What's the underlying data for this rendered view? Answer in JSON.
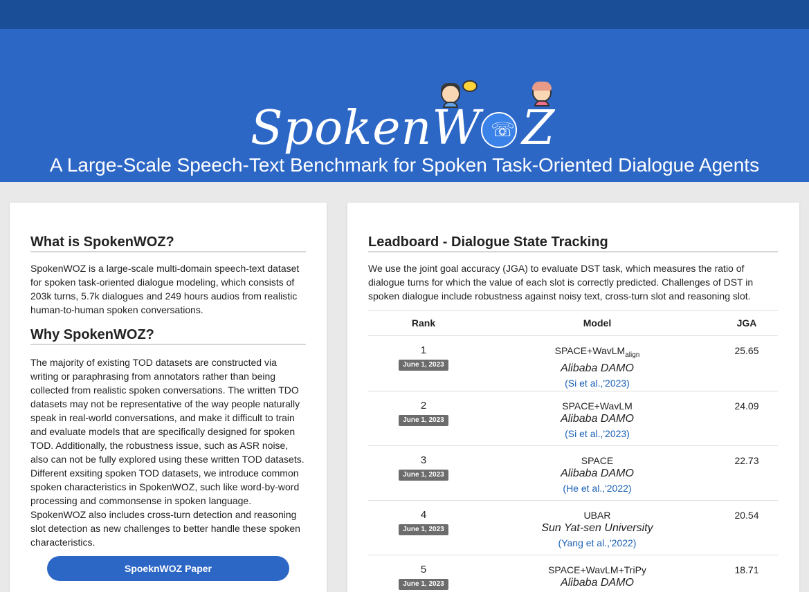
{
  "header": {
    "logo_text": "SpokenW",
    "logo_text_end": "Z",
    "phone_icon": "☏",
    "subtitle": "A Large-Scale Speech-Text Benchmark for Spoken Task-Oriented Dialogue Agents"
  },
  "about": {
    "what_title": "What is SpokenWOZ?",
    "what_text": "SpokenWOZ is a large-scale multi-domain speech-text dataset for spoken task-oriented dialogue modeling, which consists of 203k turns, 5.7k dialogues and 249 hours audios from realistic human-to-human spoken conversations.",
    "why_title": "Why SpokenWOZ?",
    "why_text": "The majority of existing TOD datasets are constructed via writing or paraphrasing from annotators rather than being collected from realistic spoken conversations. The written TDO datasets may not be representative of the way people naturally speak in real-world conversations, and make it difficult to train and evaluate models that are specifically designed for spoken TOD. Additionally, the robustness issue, such as ASR noise, also can not be fully explored using these written TOD datasets. Different exsiting spoken TOD datasets, we introduce common spoken characteristics in SpokenWOZ, such like word-by-word processing and commonsense in spoken language. SpokenWOZ also includes cross-turn detection and reasoning slot detection as new challenges to better handle these spoken characteristics.",
    "paper_button": "SpoeknWOZ Paper"
  },
  "leaderboard": {
    "title": "Leadboard - Dialogue State Tracking",
    "description": "We use the joint goal accuracy (JGA) to evaluate DST task, which measures the ratio of dialogue turns for which the value of each slot is correctly predicted. Challenges of DST in spoken dialogue include robustness against noisy text, cross-turn slot and reasoning slot.",
    "columns": [
      "Rank",
      "Model",
      "JGA"
    ],
    "rows": [
      {
        "rank": "1",
        "date": "June 1, 2023",
        "model": "SPACE+WavLM",
        "model_sub": "align",
        "org": "Alibaba DAMO",
        "cite": "(Si et al.,'2023)",
        "jga": "25.65"
      },
      {
        "rank": "2",
        "date": "June 1, 2023",
        "model": "SPACE+WavLM",
        "model_sub": "",
        "org": "Alibaba DAMO",
        "cite": "(Si et al.,'2023)",
        "jga": "24.09"
      },
      {
        "rank": "3",
        "date": "June 1, 2023",
        "model": "SPACE",
        "model_sub": "",
        "org": "Alibaba DAMO",
        "cite": "(He et al.,'2022)",
        "jga": "22.73"
      },
      {
        "rank": "4",
        "date": "June 1, 2023",
        "model": "UBAR",
        "model_sub": "",
        "org": "Sun Yat-sen University",
        "cite": "(Yang et al.,'2022)",
        "jga": "20.54"
      },
      {
        "rank": "5",
        "date": "June 1, 2023",
        "model": "SPACE+WavLM+TriPy",
        "model_sub": "",
        "org": "Alibaba DAMO",
        "cite": "",
        "jga": "18.71"
      }
    ]
  }
}
